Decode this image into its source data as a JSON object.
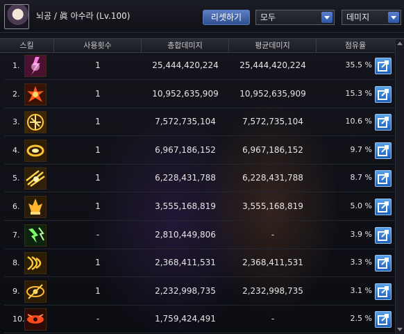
{
  "header": {
    "title": "뇌공 / 眞 아수라 (Lv.100)",
    "reset_label": "리셋하기",
    "filter_select": "모두",
    "metric_select": "데미지"
  },
  "columns": [
    "스킬",
    "사용횟수",
    "총합데미지",
    "평균데미지",
    "점유율"
  ],
  "rows": [
    {
      "rank": "1.",
      "icon": "lightning-skill-icon",
      "uses": "1",
      "total": "25,444,420,224",
      "avg": "25,444,420,224",
      "share": "35.5 %"
    },
    {
      "rank": "2.",
      "icon": "fire-burst-skill-icon",
      "uses": "1",
      "total": "10,952,635,909",
      "avg": "10,952,635,909",
      "share": "15.3 %"
    },
    {
      "rank": "3.",
      "icon": "wave-circle-skill-icon",
      "uses": "1",
      "total": "7,572,735,104",
      "avg": "7,572,735,104",
      "share": "10.6 %"
    },
    {
      "rank": "4.",
      "icon": "ring-skill-icon",
      "uses": "1",
      "total": "6,967,186,152",
      "avg": "6,967,186,152",
      "share": "9.7 %"
    },
    {
      "rank": "5.",
      "icon": "slash-burst-skill-icon",
      "uses": "1",
      "total": "6,228,431,788",
      "avg": "6,228,431,788",
      "share": "8.7 %"
    },
    {
      "rank": "6.",
      "icon": "flame-spike-skill-icon",
      "uses": "1",
      "total": "3,555,168,819",
      "avg": "3,555,168,819",
      "share": "5.0 %"
    },
    {
      "rank": "7.",
      "icon": "green-shards-skill-icon",
      "uses": "-",
      "total": "2,810,449,806",
      "avg": "-",
      "share": "3.9 %"
    },
    {
      "rank": "8.",
      "icon": "arrow-wave-skill-icon",
      "uses": "1",
      "total": "2,368,411,531",
      "avg": "2,368,411,531",
      "share": "3.3 %"
    },
    {
      "rank": "9.",
      "icon": "eye-slash-skill-icon",
      "uses": "1",
      "total": "2,232,998,735",
      "avg": "2,232,998,735",
      "share": "3.1 %"
    },
    {
      "rank": "10.",
      "icon": "demon-eye-skill-icon",
      "uses": "-",
      "total": "1,759,424,491",
      "avg": "-",
      "share": "2.5 %"
    }
  ],
  "colors": {
    "accent_button": "#2f56a8",
    "detail_button": "#1f5fb8",
    "icon_frame": "#3b2a14"
  }
}
